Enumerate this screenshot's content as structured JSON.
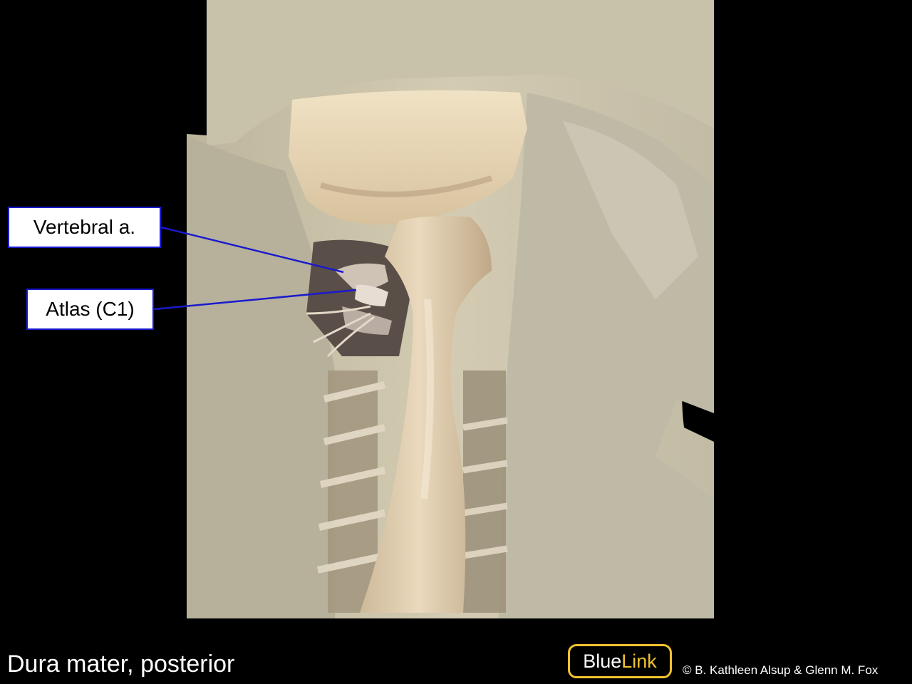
{
  "labels": {
    "vertebral_artery": "Vertebral a.",
    "atlas": "Atlas (C1)"
  },
  "caption": "Dura mater, posterior",
  "logo": {
    "part1": "Blue",
    "part2": "Link"
  },
  "copyright": "© B. Kathleen Alsup & Glenn M. Fox",
  "colors": {
    "label_border": "#1a1acc",
    "leader_line": "#1a1acc",
    "logo_accent": "#f2c230",
    "background": "#000000"
  }
}
